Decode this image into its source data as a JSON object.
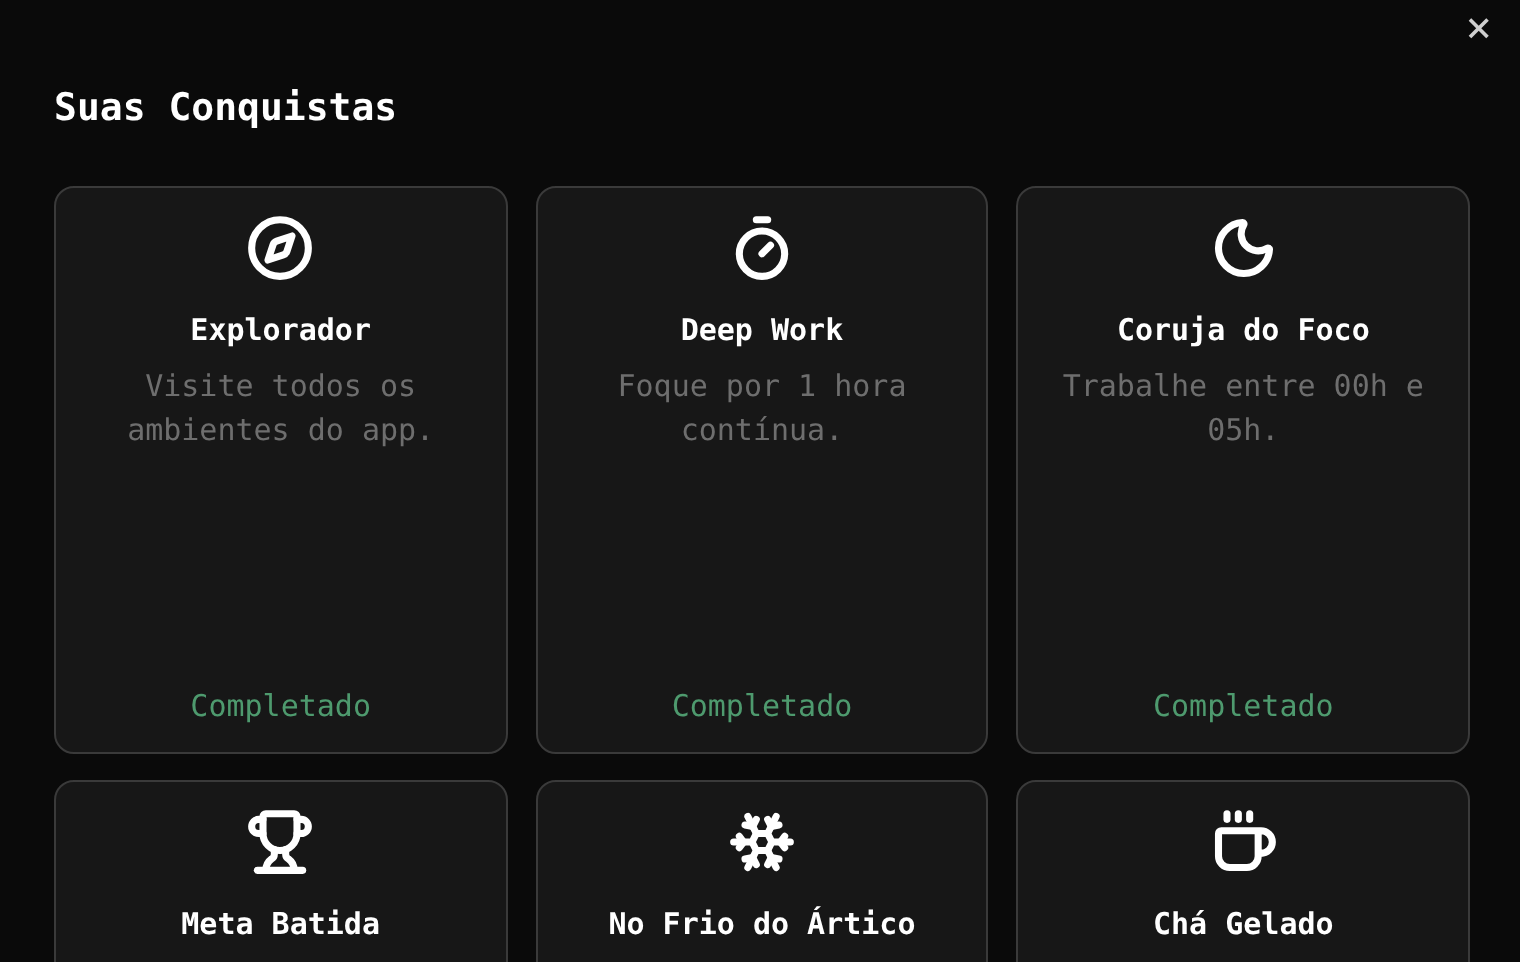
{
  "close_label": "×",
  "title": "Suas Conquistas",
  "achievements": [
    {
      "name": "Explorador",
      "description": "Visite todos os ambientes do app.",
      "status": "Completado",
      "completed": true
    },
    {
      "name": "Deep Work",
      "description": "Foque por 1 hora contínua.",
      "status": "Completado",
      "completed": true
    },
    {
      "name": "Coruja do Foco",
      "description": "Trabalhe entre 00h e 05h.",
      "status": "Completado",
      "completed": true
    },
    {
      "name": "Meta Batida"
    },
    {
      "name": "No Frio do Ártico"
    },
    {
      "name": "Chá Gelado"
    }
  ]
}
